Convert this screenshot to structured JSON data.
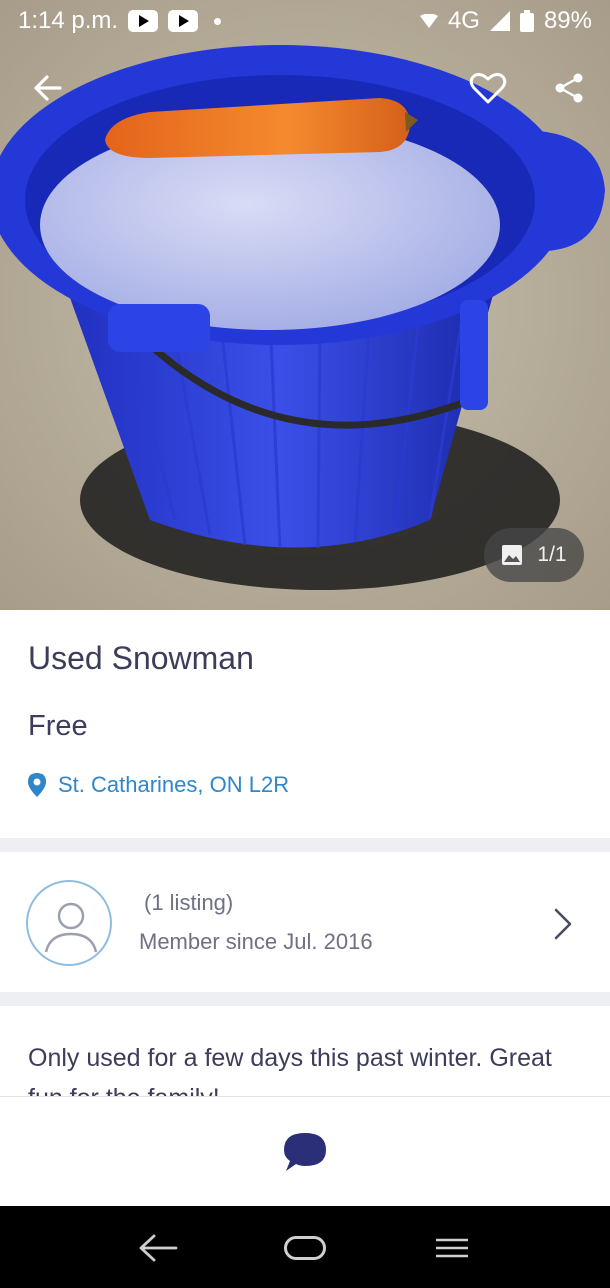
{
  "status_bar": {
    "time": "1:14 p.m.",
    "network": "4G",
    "battery": "89%"
  },
  "hero": {
    "photo_counter": "1/1",
    "icons": [
      "back-arrow-icon",
      "heart-icon",
      "share-icon",
      "image-icon"
    ]
  },
  "listing": {
    "title": "Used Snowman",
    "price": "Free",
    "location": "St. Catharines, ON L2R"
  },
  "seller": {
    "listing_count": "(1 listing)",
    "member_since": "Member since Jul. 2016"
  },
  "description": {
    "text": "Only used for a few days this past winter. Great fun for the family!"
  },
  "colors": {
    "accent_blue": "#2f86c9",
    "text_dark": "#3b3d5a",
    "chat_icon": "#2b2f78"
  }
}
